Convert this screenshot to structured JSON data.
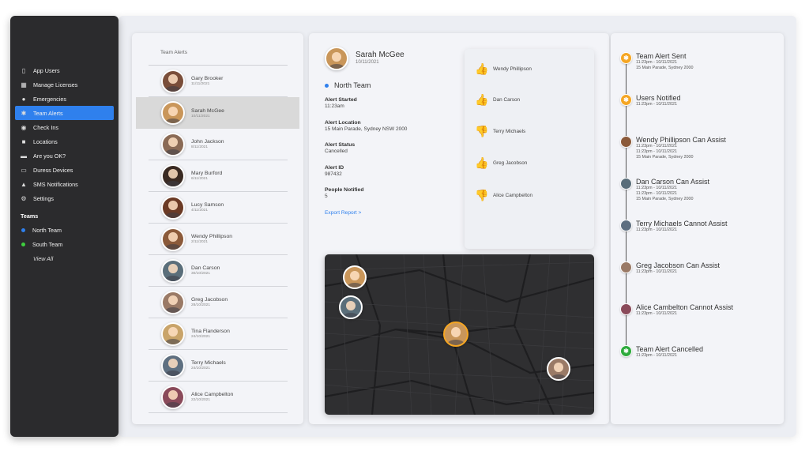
{
  "sidebar": {
    "items": [
      {
        "label": "App Users",
        "icon": "phone-icon"
      },
      {
        "label": "Manage Licenses",
        "icon": "license-icon"
      },
      {
        "label": "Emergencies",
        "icon": "emergency-icon"
      },
      {
        "label": "Team Alerts",
        "icon": "team-alert-icon",
        "active": true
      },
      {
        "label": "Check Ins",
        "icon": "location-pin-icon"
      },
      {
        "label": "Locations",
        "icon": "building-icon"
      },
      {
        "label": "Are you OK?",
        "icon": "chat-icon"
      },
      {
        "label": "Duress Devices",
        "icon": "device-icon"
      },
      {
        "label": "SMS Notifications",
        "icon": "bell-icon"
      },
      {
        "label": "Settings",
        "icon": "gear-icon"
      }
    ],
    "teams_heading": "Teams",
    "teams": [
      {
        "label": "North Team",
        "color": "#2f80ed"
      },
      {
        "label": "South Team",
        "color": "#3ecf3e"
      }
    ],
    "view_all": "View All"
  },
  "alerts": {
    "title": "Team Alerts",
    "rows": [
      {
        "name": "Gary Brooker",
        "date": "11/11/2021"
      },
      {
        "name": "Sarah McGee",
        "date": "10/11/2021",
        "selected": true
      },
      {
        "name": "John Jackson",
        "date": "8/11/2021"
      },
      {
        "name": "Mary Burford",
        "date": "6/11/2021"
      },
      {
        "name": "Lucy Samson",
        "date": "4/11/2021"
      },
      {
        "name": "Wendy Phillipson",
        "date": "2/11/2021"
      },
      {
        "name": "Dan Carson",
        "date": "30/10/2021"
      },
      {
        "name": "Greg Jacobson",
        "date": "28/10/2021"
      },
      {
        "name": "Tina Flanderson",
        "date": "24/10/2021"
      },
      {
        "name": "Terry Michaels",
        "date": "24/10/2021"
      },
      {
        "name": "Alice Campbelton",
        "date": "22/10/2021"
      }
    ]
  },
  "detail": {
    "name": "Sarah McGee",
    "date": "10/11/2021",
    "team": "North Team",
    "fields": [
      {
        "label": "Alert Started",
        "value": "11:23am"
      },
      {
        "label": "Alert Location",
        "value": "15 Main Parade, Sydney NSW 2000"
      },
      {
        "label": "Alert Status",
        "value": "Cancelled"
      },
      {
        "label": "Alert ID",
        "value": "987432"
      },
      {
        "label": "People Notified",
        "value": "5"
      }
    ],
    "export_label": "Export Report >"
  },
  "responses": [
    {
      "name": "Wendy Phillipson",
      "response": "up"
    },
    {
      "name": "Dan Carson",
      "response": "up"
    },
    {
      "name": "Terry Michaels",
      "response": "down"
    },
    {
      "name": "Greg Jacobson",
      "response": "up"
    },
    {
      "name": "Alice Campbelton",
      "response": "down"
    }
  ],
  "timeline": [
    {
      "title": "Team Alert Sent",
      "lines": [
        "11:23pm - 10/11/2021",
        "15 Main Parade, Sydney 2000"
      ],
      "marker": "orange"
    },
    {
      "title": "Users Notified",
      "lines": [
        "11:23pm - 10/11/2021"
      ],
      "marker": "orange"
    },
    {
      "title": "Wendy Phillipson Can Assist",
      "lines": [
        "11:23pm - 10/11/2021",
        "11:23pm - 10/11/2021",
        "15 Main Parade, Sydney 2000"
      ],
      "marker": "avatar"
    },
    {
      "title": "Dan Carson Can Assist",
      "lines": [
        "11:23pm - 10/11/2021",
        "11:23pm - 10/11/2021",
        "15 Main Parade, Sydney 2000"
      ],
      "marker": "avatar"
    },
    {
      "title": "Terry Michaels Cannot Assist",
      "lines": [
        "11:23pm - 10/11/2021"
      ],
      "marker": "avatar"
    },
    {
      "title": "Greg Jacobson Can Assist",
      "lines": [
        "11:23pm - 10/11/2021"
      ],
      "marker": "avatar"
    },
    {
      "title": "Alice Cambelton Cannot Assist",
      "lines": [
        "11:23pm - 10/11/2021"
      ],
      "marker": "avatar"
    },
    {
      "title": "Team Alert Cancelled",
      "lines": [
        "11:23pm - 10/11/2021"
      ],
      "marker": "green"
    }
  ]
}
